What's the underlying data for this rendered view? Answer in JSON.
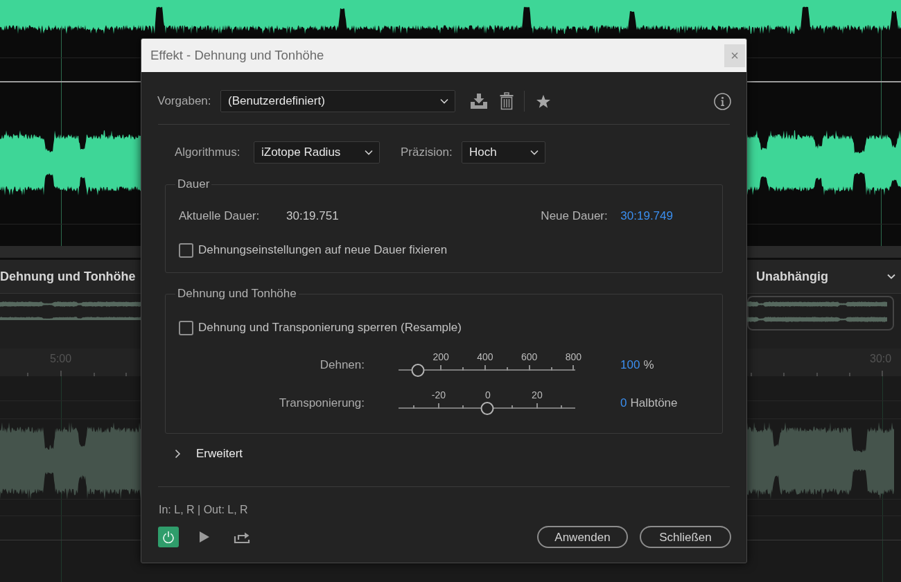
{
  "background": {
    "panel_title": "Dehnung und Tonhöhe",
    "mode_dropdown": "Unabhängig",
    "ruler_labels": [
      "5:00",
      "30:0"
    ]
  },
  "dialog": {
    "title": "Effekt - Dehnung und Tonhöhe",
    "close": "×",
    "presets": {
      "label": "Vorgaben:",
      "value": "(Benutzerdefiniert)"
    },
    "algorithm": {
      "label": "Algorithmus:",
      "value": "iZotope Radius"
    },
    "precision": {
      "label": "Präzision:",
      "value": "Hoch"
    },
    "duration": {
      "title": "Dauer",
      "current_label": "Aktuelle Dauer:",
      "current_value": "30:19.751",
      "new_label": "Neue Dauer:",
      "new_value": "30:19.749",
      "lock": {
        "label": "Dehnungseinstellungen auf neue Dauer fixieren",
        "checked": false
      }
    },
    "stretch_pitch": {
      "title": "Dehnung und Tonhöhe",
      "lock": {
        "label": "Dehnung und Transponierung sperren (Resample)",
        "checked": false
      },
      "sliders": [
        {
          "label": "Dehnen:",
          "ticks": [
            "200",
            "400",
            "600",
            "800"
          ],
          "level": 0.11,
          "value": "100",
          "unit": "%"
        },
        {
          "label": "Transponierung:",
          "ticks": [
            "-20",
            "0",
            "20"
          ],
          "level": 0.5,
          "value": "0",
          "unit": "Halbtöne"
        }
      ]
    },
    "advanced": {
      "label": "Erweitert",
      "expanded": false
    },
    "routing": "In: L, R | Out: L, R",
    "power": {
      "on": true
    },
    "buttons": [
      "Anwenden",
      "Schließen"
    ]
  }
}
